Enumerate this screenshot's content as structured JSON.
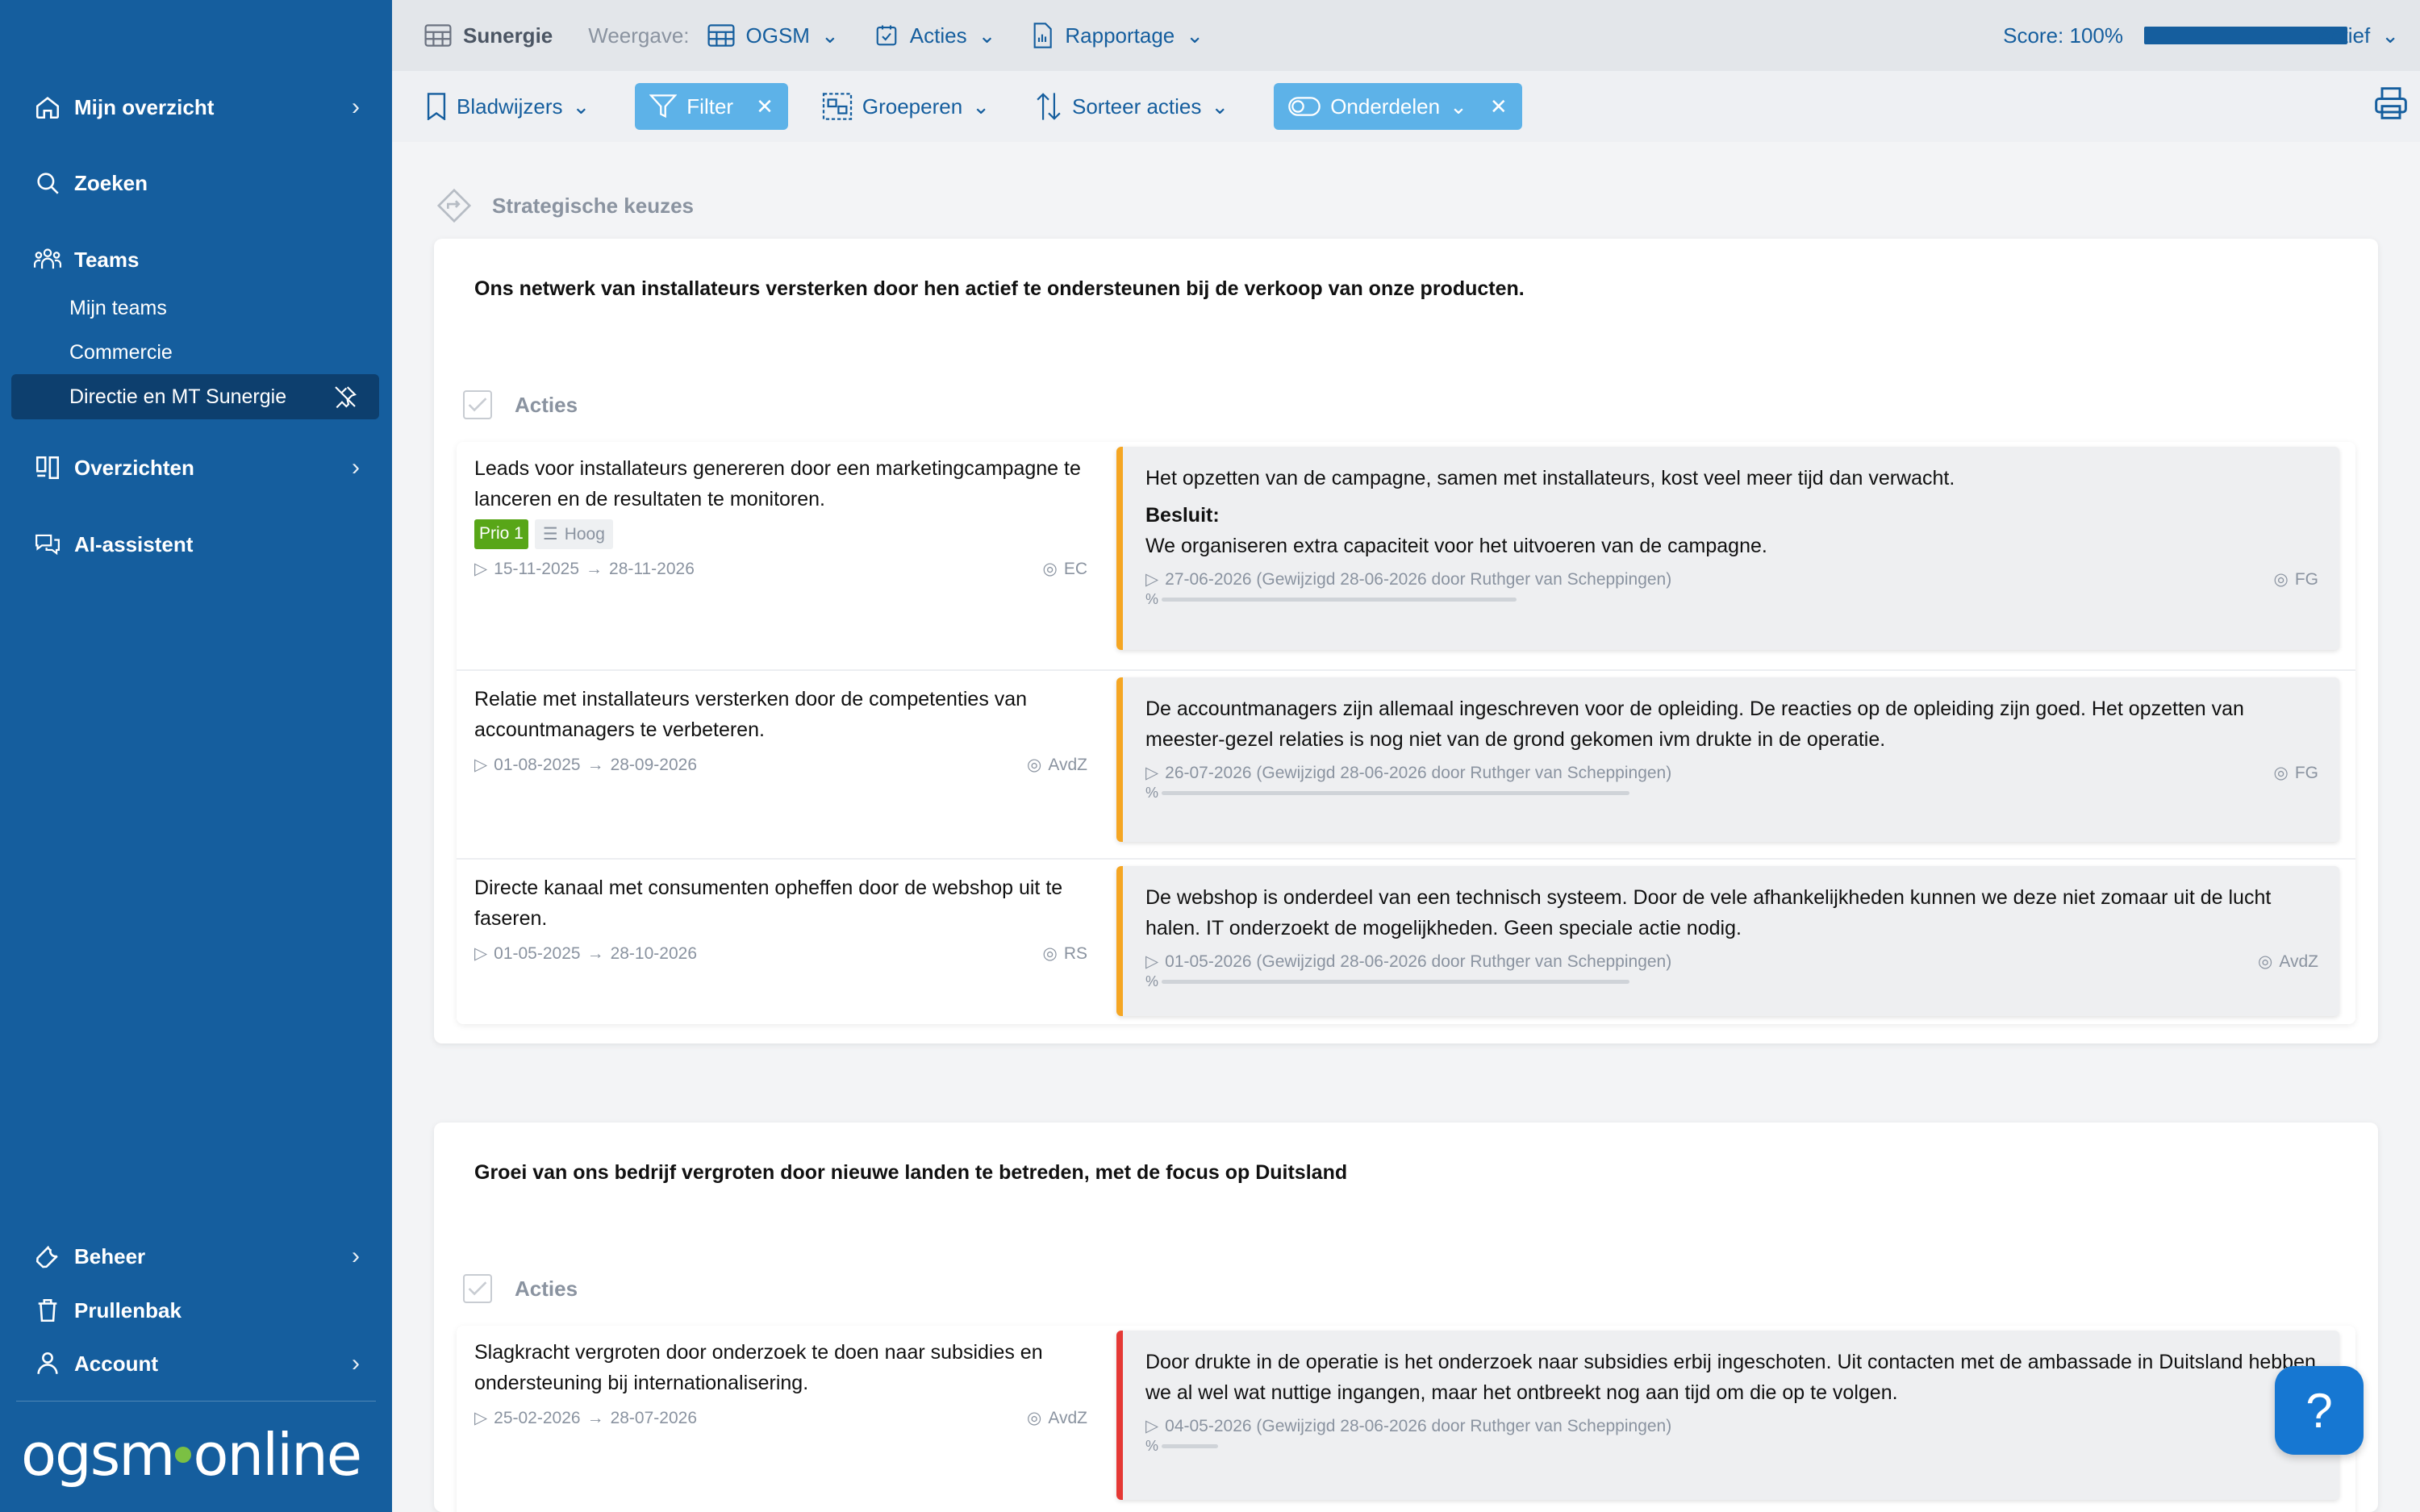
{
  "sidebar": {
    "items": [
      {
        "label": "Mijn overzicht"
      },
      {
        "label": "Zoeken"
      },
      {
        "label": "Teams"
      },
      {
        "label": "Overzichten"
      },
      {
        "label": "AI-assistent"
      }
    ],
    "teams": {
      "sub": [
        "Mijn teams",
        "Commercie"
      ],
      "active": "Directie en MT Sunergie"
    },
    "bottom": [
      {
        "label": "Beheer"
      },
      {
        "label": "Prullenbak"
      },
      {
        "label": "Account"
      }
    ],
    "logo": {
      "left": "ogsm",
      "right": "online"
    }
  },
  "topbar": {
    "crumb": "Sunergie",
    "weergave_label": "Weergave:",
    "ogsm": "OGSM",
    "acties": "Acties",
    "rapportage": "Rapportage",
    "score_label": "Score: 100%",
    "score_fraction": 1.0,
    "status": "Actief"
  },
  "toolbar": {
    "bookmarks": "Bladwijzers",
    "filter": "Filter",
    "group": "Groeperen",
    "sort": "Sorteer acties",
    "parts": "Onderdelen"
  },
  "section": {
    "title": "Strategische keuzes"
  },
  "cards": [
    {
      "title": "Ons netwerk van installateurs versterken door hen actief te ondersteunen bij de verkoop van onze producten.",
      "acties_label": "Acties",
      "rows": [
        {
          "action": "Leads voor installateurs genereren door een marketingcampagne te lanceren en de resultaten te monitoren.",
          "prio": "Prio 1",
          "level": "Hoog",
          "start": "15-11-2025",
          "end": "28-11-2026",
          "owner": "EC",
          "update": "Het opzetten van de campagne, samen met installateurs, kost veel meer tijd dan verwacht.",
          "besluit_label": "Besluit:",
          "besluit": "We organiseren extra capaciteit voor het uitvoeren van de campagne.",
          "update_meta": "27-06-2026 (Gewijzigd 28-06-2026 door Ruthger van Scheppingen)",
          "update_owner": "FG",
          "pct": "%"
        },
        {
          "action": "Relatie met installateurs versterken door de competenties van accountmanagers te verbeteren.",
          "start": "01-08-2025",
          "end": "28-09-2026",
          "owner": "AvdZ",
          "update": "De accountmanagers zijn allemaal ingeschreven voor de opleiding. De reacties op de opleiding zijn goed. Het opzetten van meester-gezel relaties is nog niet van de grond gekomen ivm drukte in de operatie.",
          "update_meta": "26-07-2026 (Gewijzigd 28-06-2026 door Ruthger van Scheppingen)",
          "update_owner": "FG",
          "pct": "%"
        },
        {
          "action": "Directe kanaal met consumenten opheffen door de webshop uit te faseren.",
          "start": "01-05-2025",
          "end": "28-10-2026",
          "owner": "RS",
          "update": "De webshop is onderdeel van een technisch systeem. Door de vele afhankelijkheden kunnen we deze niet zomaar uit de lucht halen. IT onderzoekt de mogelijkheden. Geen speciale actie nodig.",
          "update_meta": "01-05-2026 (Gewijzigd 28-06-2026 door Ruthger van Scheppingen)",
          "update_owner": "AvdZ",
          "pct": "%"
        }
      ]
    },
    {
      "title": "Groei van ons bedrijf vergroten door nieuwe landen te betreden, met de focus op Duitsland",
      "acties_label": "Acties",
      "rows": [
        {
          "action": "Slagkracht vergroten door onderzoek te doen naar subsidies en ondersteuning bij internationalisering.",
          "start": "25-02-2026",
          "end": "28-07-2026",
          "owner": "AvdZ",
          "update": "Door drukte in de operatie is het onderzoek naar subsidies erbij ingeschoten. Uit contacten met de ambassade in Duitsland hebben we al wel wat nuttige ingangen, maar het ontbreekt nog aan tijd om die op te volgen.",
          "update_meta": "04-05-2026 (Gewijzigd 28-06-2026 door Ruthger van Scheppingen)",
          "update_owner": "A",
          "pct": "%"
        }
      ]
    }
  ],
  "help": "?",
  "colors": {
    "sidebar": "#155e9e",
    "accent": "#5db2e8",
    "orange": "#f5a623",
    "red": "#e53935",
    "prio": "#58a618"
  }
}
